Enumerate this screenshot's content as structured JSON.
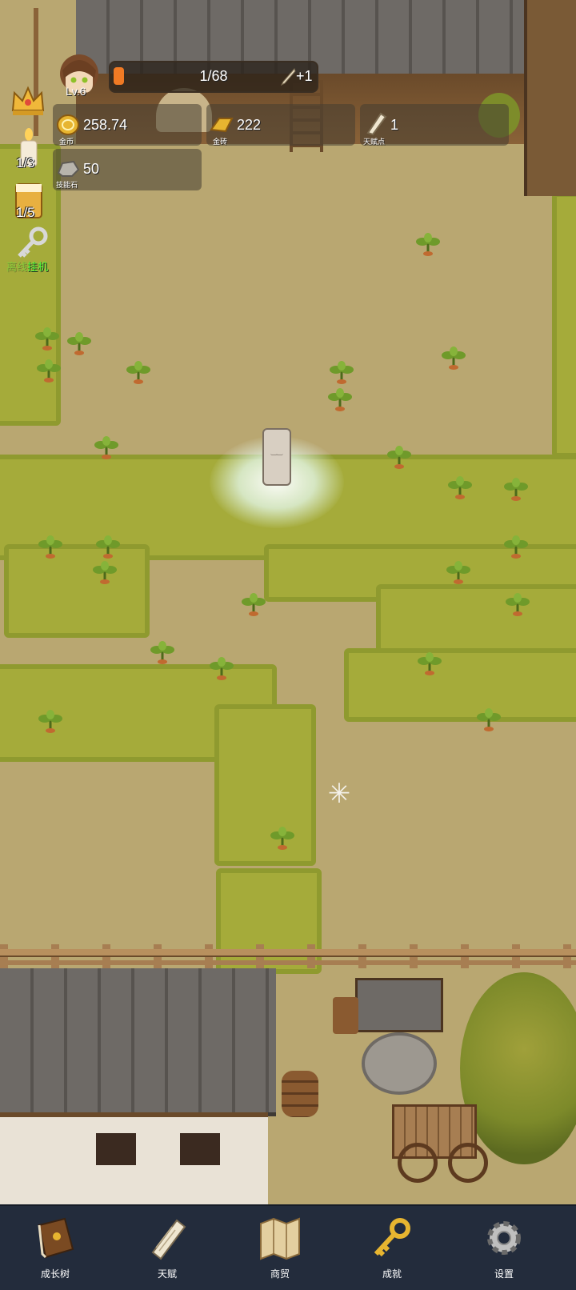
{
  "player": {
    "level": "Lv.6",
    "exp_text": "1/68",
    "exp_progress": 0.015,
    "talent_gain": "+1"
  },
  "resources": {
    "gold": {
      "value": "258.74",
      "label": "金币"
    },
    "gold_bar": {
      "value": "222",
      "label": "金砖"
    },
    "talent_points": {
      "value": "1",
      "label": "天赋点"
    },
    "skill_stone": {
      "value": "50",
      "label": "技能石"
    }
  },
  "side": {
    "candle_count": "1/3",
    "drink_count": "1/5",
    "auto_label": "挂机",
    "auto_prefix": "离线"
  },
  "nav": [
    {
      "label": "成长树",
      "icon": "book-icon"
    },
    {
      "label": "天赋",
      "icon": "scroll-icon"
    },
    {
      "label": "商贸",
      "icon": "map-icon"
    },
    {
      "label": "成就",
      "icon": "key-icon"
    },
    {
      "label": "设置",
      "icon": "gear-icon"
    }
  ],
  "colors": {
    "dirt": "#b9a771",
    "grass": "#a5ab3a",
    "nav_bg": "#232c3c",
    "exp_fill": "#f07a24",
    "auto_text": "#55ff3a"
  }
}
